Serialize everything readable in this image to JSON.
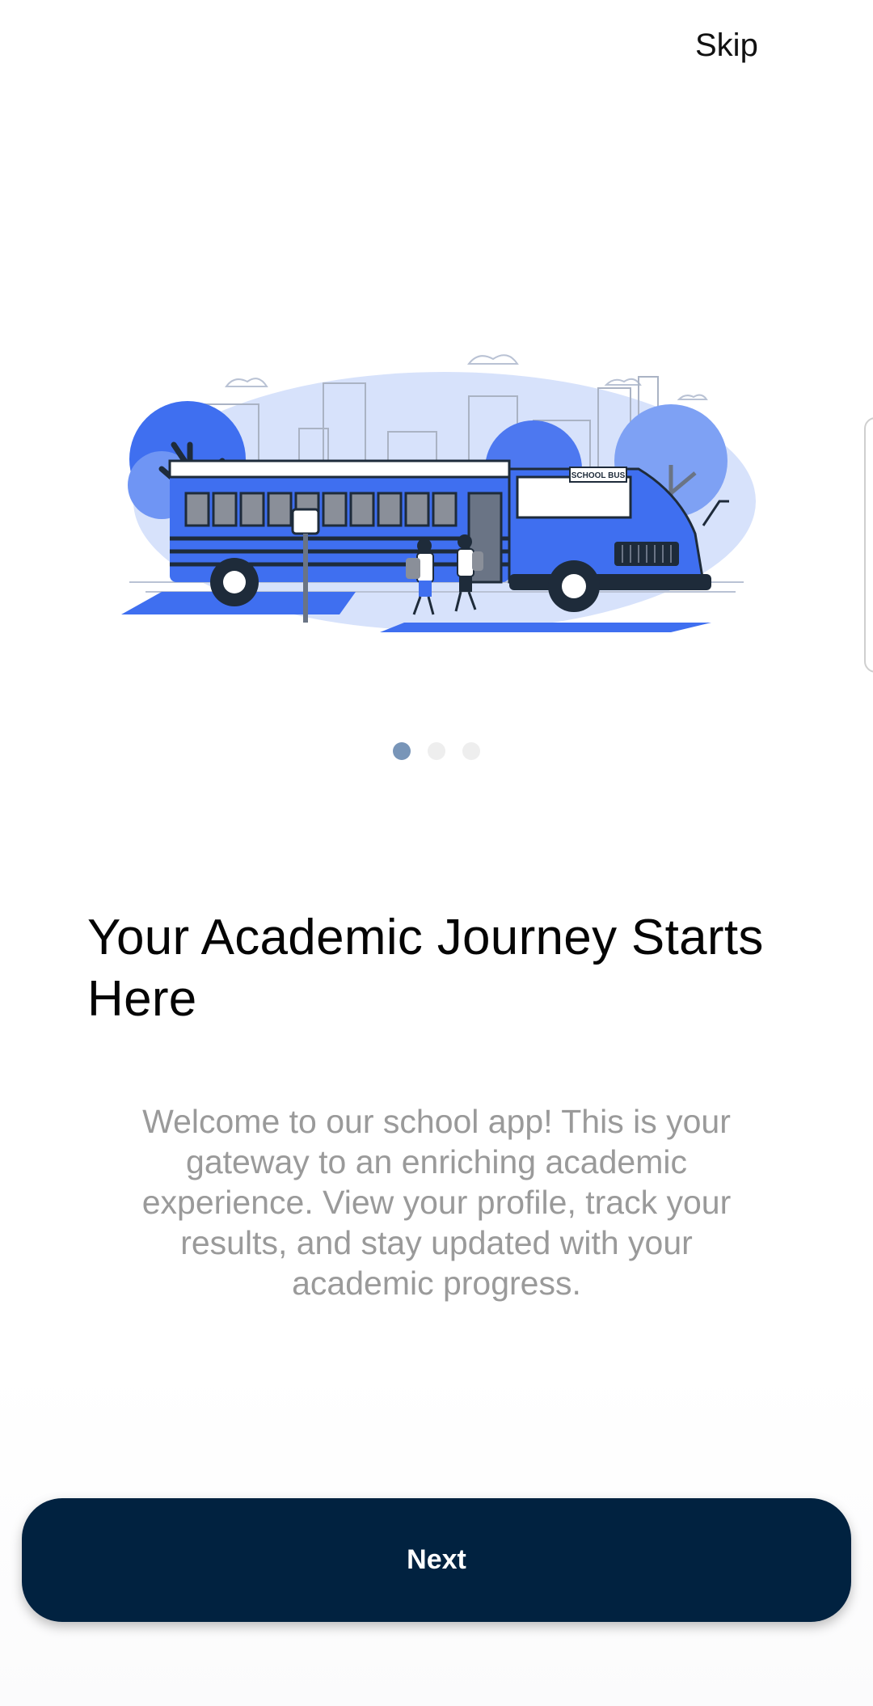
{
  "header": {
    "skip_label": "Skip"
  },
  "illustration": {
    "icon": "school-bus-illustration",
    "bus_sign": "SCHOOL BUS"
  },
  "pagination": {
    "total": 3,
    "active": 1
  },
  "onboarding": {
    "title": "Your Academic Journey Starts Here",
    "description": "Welcome to our school app! This is your gateway to an enriching academic experience. View your profile, track your results, and stay updated with your academic progress."
  },
  "actions": {
    "next_label": "Next"
  },
  "colors": {
    "primary": "#012240",
    "accent_blue": "#3f6ff0",
    "dot_active": "#7895b8",
    "dot_inactive": "#eeeeee",
    "body_text": "#9a9a9a"
  }
}
